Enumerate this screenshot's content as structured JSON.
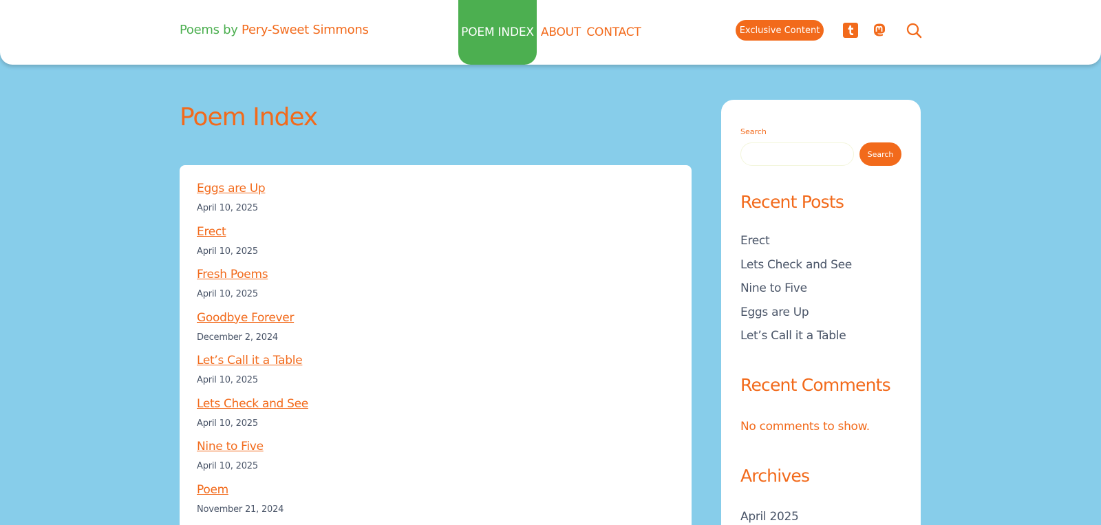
{
  "header": {
    "site_title_part1": "Poems by ",
    "site_title_part2": "Pery-Sweet Simmons",
    "nav": [
      {
        "label": "POEM INDEX",
        "active": true
      },
      {
        "label": "ABOUT",
        "active": false
      },
      {
        "label": "CONTACT",
        "active": false
      }
    ],
    "exclusive_label": "Exclusive Content",
    "social_icons": [
      "tumblr-icon",
      "mastodon-icon"
    ],
    "search_icon": "search-icon"
  },
  "main": {
    "page_title": "Poem Index",
    "poems": [
      {
        "title": "Eggs are Up",
        "date": "April 10, 2025"
      },
      {
        "title": "Erect",
        "date": "April 10, 2025"
      },
      {
        "title": "Fresh Poems",
        "date": "April 10, 2025"
      },
      {
        "title": "Goodbye Forever",
        "date": "December 2, 2024"
      },
      {
        "title": "Let’s Call it a Table",
        "date": "April 10, 2025"
      },
      {
        "title": "Lets Check and See",
        "date": "April 10, 2025"
      },
      {
        "title": "Nine to Five",
        "date": "April 10, 2025"
      },
      {
        "title": "Poem",
        "date": "November 21, 2024"
      }
    ]
  },
  "sidebar": {
    "search_label": "Search",
    "search_placeholder": "",
    "search_button": "Search",
    "recent_posts_title": "Recent Posts",
    "recent_posts": [
      "Erect",
      "Lets Check and See",
      "Nine to Five",
      "Eggs are Up",
      "Let’s Call it a Table"
    ],
    "recent_comments_title": "Recent Comments",
    "no_comments": "No comments to show.",
    "archives_title": "Archives",
    "archives": [
      "April 2025"
    ]
  },
  "colors": {
    "background": "#87cdea",
    "accent": "#f26a1b",
    "green": "#4caf50",
    "text": "#4a5568"
  }
}
